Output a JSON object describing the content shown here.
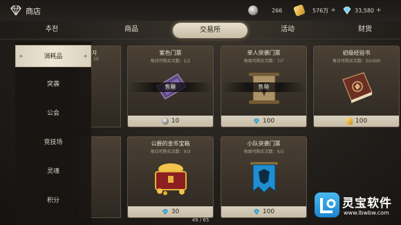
{
  "header": {
    "title": "商店",
    "resources": [
      {
        "icon": "silver-coin-icon",
        "value": "266"
      },
      {
        "icon": "gold-coin-icon",
        "value": "576万",
        "plus": "+"
      },
      {
        "icon": "diamond-icon",
        "value": "33,580",
        "plus": "+"
      }
    ]
  },
  "tabs": [
    "추천",
    "商品",
    "交易所",
    "活动",
    "财货"
  ],
  "active_tab": "交易所",
  "sidebar": {
    "items": [
      "消耗品",
      "突袭",
      "公会",
      "竞技场",
      "灵魂",
      "积分"
    ],
    "active": "消耗品"
  },
  "cards": [
    {
      "name": "紫色门票",
      "limit": "每日可购买次数：1/1",
      "sold_label": "售罄",
      "price": "10",
      "currency_icon": "silver-coin-icon",
      "art_icon": "purple-ticket-icon",
      "sold_out": true
    },
    {
      "name": "单人突袭门票",
      "limit": "每周可购买次数：7/7",
      "sold_label": "售罄",
      "price": "100",
      "currency_icon": "diamond-icon",
      "art_icon": "scroll-ticket-icon",
      "sold_out": true
    },
    {
      "name": "初级经验书",
      "limit": "每日可购买次数：0/1000",
      "price": "100",
      "currency_icon": "gold-coin-icon",
      "art_icon": "exp-book-icon",
      "sold_out": false
    },
    {
      "name": "公爵的金币宝箱",
      "limit": "每日可购买次数：0/3",
      "price": "30",
      "currency_icon": "diamond-icon",
      "art_icon": "treasure-chest-icon",
      "sold_out": false
    },
    {
      "name": "小队突袭门票",
      "limit": "每周可购买次数：0/3",
      "price": "100",
      "currency_icon": "diamond-icon",
      "art_icon": "blue-banner-icon",
      "sold_out": false
    }
  ],
  "partial_card": {
    "name": "자",
    "limit": "10"
  },
  "pager": "49 / 65",
  "watermark": {
    "text": "灵宝软件",
    "url": "www.lbwbw.com"
  }
}
